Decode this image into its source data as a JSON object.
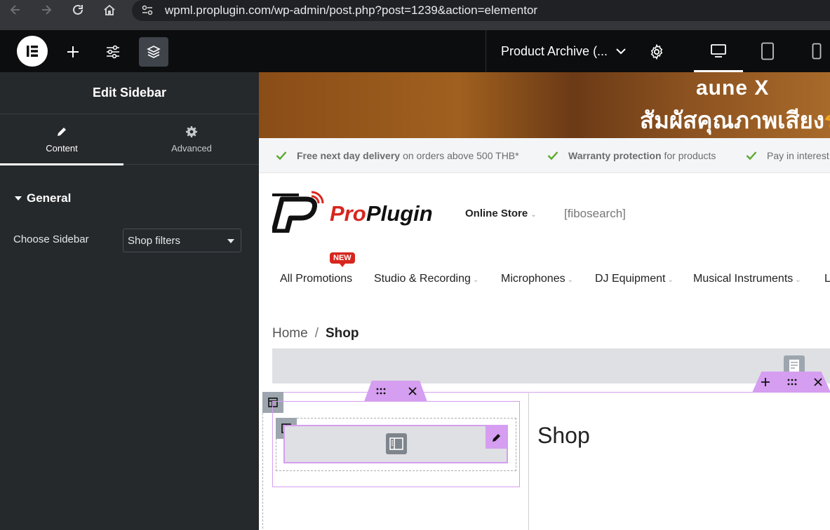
{
  "browser": {
    "url": "wpml.proplugin.com/wp-admin/post.php?post=1239&action=elementor"
  },
  "editor": {
    "document_title": "Product Archive (...",
    "panel_title": "Edit Sidebar",
    "tabs": [
      {
        "label": "Content",
        "icon": "pencil-icon",
        "active": true
      },
      {
        "label": "Advanced",
        "icon": "gear-icon",
        "active": false
      }
    ],
    "section_title": "General",
    "control_label": "Choose Sidebar",
    "select_value": "Shop filters"
  },
  "site": {
    "banner_brand": "aune X",
    "banner_thai": "สัมผัสคุณภาพเสียง",
    "banner_thai_highlight": "ร",
    "benefits": [
      {
        "bold": "Free next day delivery",
        "text": "on orders above 500 THB*"
      },
      {
        "bold": "Warranty protection",
        "text": "for products"
      },
      {
        "bold": "",
        "text": "Pay in interest"
      }
    ],
    "logo_text": "ProPlugin",
    "online_store": "Online Store",
    "search_shortcode": "[fibosearch]",
    "new_badge": "NEW",
    "nav": [
      "All Promotions",
      "Studio & Recording",
      "Microphones",
      "DJ Equipment",
      "Musical Instruments",
      "L"
    ],
    "breadcrumb": {
      "home": "Home",
      "separator": "/",
      "current": "Shop"
    },
    "page_heading": "Shop"
  },
  "colors": {
    "elementor_accent": "#d59ef0",
    "check_green": "#5aa92d",
    "badge_red": "#d7261e"
  }
}
